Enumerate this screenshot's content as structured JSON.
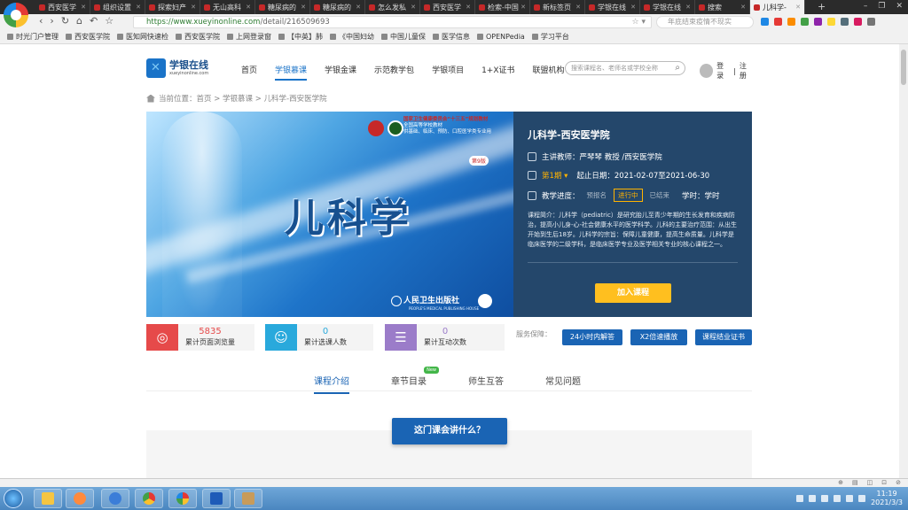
{
  "browser": {
    "tabs": [
      {
        "label": "西安医学"
      },
      {
        "label": "组织设置"
      },
      {
        "label": "探索妇产"
      },
      {
        "label": "无山高科"
      },
      {
        "label": "糖尿病的"
      },
      {
        "label": "糖尿病的"
      },
      {
        "label": "怎么发私"
      },
      {
        "label": "西安医学"
      },
      {
        "label": "检索-中国"
      },
      {
        "label": "新标签页"
      },
      {
        "label": "学银在线"
      },
      {
        "label": "学银在线"
      },
      {
        "label": "搜索"
      },
      {
        "label": "儿科学-"
      }
    ],
    "url_host": "https://www.xueyinonline.com",
    "url_path": "/detail/216509693",
    "search_placeholder": "年底结束疫情不现实",
    "bookmarks": [
      "时光门户管理",
      "西安医学院",
      "医知网快速检",
      "西安医学院",
      "上网登录窗",
      "【中英】肺",
      "《中国妇幼",
      "中国儿童保",
      "医学信息",
      "OPENPedia",
      "学习平台"
    ]
  },
  "site": {
    "brand_name": "学银在线",
    "brand_url": "xueyinonline.com",
    "menu": [
      "首页",
      "学银慕课",
      "学银金课",
      "示范教学包",
      "学银项目",
      "1+X证书",
      "联盟机构"
    ],
    "search_placeholder": "搜索课程名、老师名或学校全称",
    "login": "登录",
    "register": "注册"
  },
  "breadcrumb": "当前位置：首页 > 学银慕课 > 儿科学-西安医学院",
  "cover": {
    "pub_line1": "国家卫生健康委员会“十三五”规划教材",
    "pub_line2": "全国高等学校教材",
    "pub_line3": "供基础、临床、预防、口腔医学类专业用",
    "edition": "第9版",
    "title": "儿科学",
    "publisher": "人民卫生出版社",
    "publisher_en": "PEOPLE'S MEDICAL PUBLISHING HOUSE"
  },
  "course": {
    "title": "儿科学-西安医学院",
    "teacher": "主讲教师：严琴琴 教授 /西安医学院",
    "term": "第1期 ▾",
    "dates": "起止日期：2021-02-07至2021-06-30",
    "progress_label": "教学进度：",
    "states": [
      "预报名",
      "进行中",
      "已结束"
    ],
    "hours": "学时：学时",
    "intro": "课程简介：儿科学（pediatric）是研究胎儿至青少年期的生长发育和疾病防治，提高小儿身-心-社会健康水平的医学科学。儿科的主要治疗范围：从出生开始到生后18岁。儿科学的宗旨：保障儿童健康，提高生命质量。儿科学是临床医学的二级学科，是临床医学专业及医学相关专业的核心课程之一。",
    "join": "加入课程"
  },
  "stats": [
    {
      "value": "5835",
      "label": "累计页面浏览量",
      "color": "#e64a4a"
    },
    {
      "value": "0",
      "label": "累计选课人数",
      "color": "#29a9dc"
    },
    {
      "value": "0",
      "label": "累计互动次数",
      "color": "#9b7cc9"
    }
  ],
  "service": {
    "label": "服务保障：",
    "buttons": [
      "24小时内解答",
      "X2倍速播放",
      "课程结业证书"
    ]
  },
  "subtabs": [
    "课程介绍",
    "章节目录",
    "师生互答",
    "常见问题"
  ],
  "new_tag": "New",
  "section_button": "这门课会讲什么？",
  "taskbar": {
    "time": "11:19",
    "date": "2021/3/3"
  }
}
